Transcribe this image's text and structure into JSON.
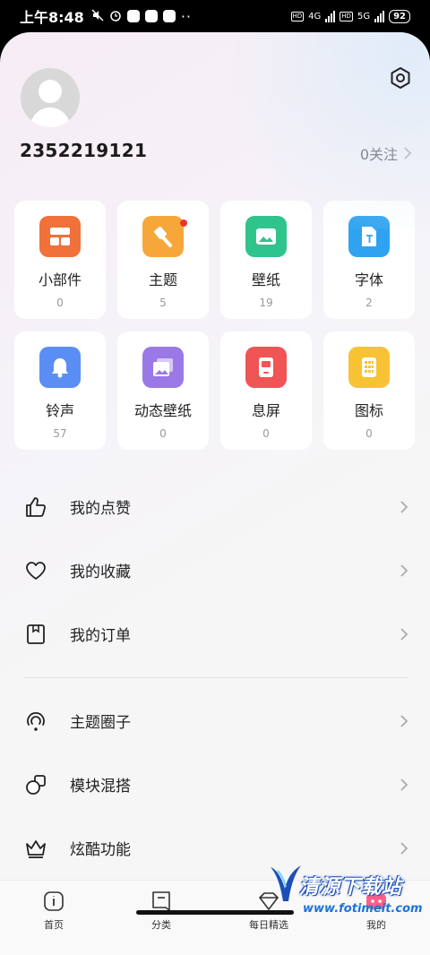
{
  "status_bar": {
    "time": "上午8:48",
    "net1": "4G",
    "net2": "5G",
    "battery": "92"
  },
  "profile": {
    "username": "2352219121",
    "follow_label": "0关注"
  },
  "tiles": [
    {
      "label": "小部件",
      "count": "0",
      "color": "#f0713a",
      "icon": "widget-icon"
    },
    {
      "label": "主题",
      "count": "5",
      "color": "#f7a73a",
      "icon": "brush-icon",
      "badge": true
    },
    {
      "label": "壁纸",
      "count": "19",
      "color": "#2fc48c",
      "icon": "image-icon"
    },
    {
      "label": "字体",
      "count": "2",
      "color": "#2fa3ef",
      "icon": "font-icon"
    },
    {
      "label": "铃声",
      "count": "57",
      "color": "#5a8ef4",
      "icon": "bell-icon"
    },
    {
      "label": "动态壁纸",
      "count": "0",
      "color": "#9a78e6",
      "icon": "live-wallpaper-icon"
    },
    {
      "label": "息屏",
      "count": "0",
      "color": "#f05454",
      "icon": "aod-icon"
    },
    {
      "label": "图标",
      "count": "0",
      "color": "#f7c234",
      "icon": "icons-grid-icon"
    }
  ],
  "menu1": [
    {
      "label": "我的点赞",
      "icon": "thumb-up-icon"
    },
    {
      "label": "我的收藏",
      "icon": "heart-icon"
    },
    {
      "label": "我的订单",
      "icon": "order-icon"
    }
  ],
  "menu2": [
    {
      "label": "主题圈子",
      "icon": "circle-icon"
    },
    {
      "label": "模块混搭",
      "icon": "module-icon"
    },
    {
      "label": "炫酷功能",
      "icon": "crown-icon"
    }
  ],
  "nav": [
    {
      "label": "首页",
      "icon": "home-icon"
    },
    {
      "label": "分类",
      "icon": "category-icon"
    },
    {
      "label": "每日精选",
      "icon": "diamond-icon"
    },
    {
      "label": "我的",
      "icon": "mine-icon"
    }
  ],
  "watermark": {
    "title": "清源下载站",
    "url": "www.fotimeit.com"
  }
}
